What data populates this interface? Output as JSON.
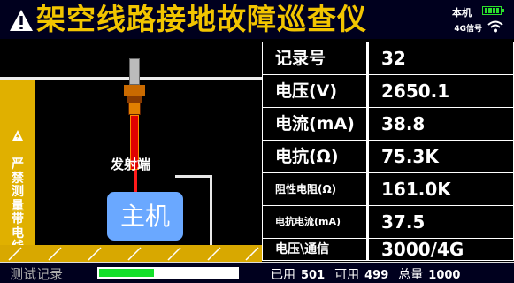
{
  "header": {
    "title": "架空线路接地故障巡查仪",
    "host_label": "本机",
    "signal_label": "4G信号",
    "battery_level": 1.0,
    "title_color": "#f2c500"
  },
  "scene": {
    "warning_text": "严禁测量带电线路",
    "emitter_label": "发射端",
    "host_box_label": "主机"
  },
  "table": {
    "rows": [
      {
        "label": "记录号",
        "value": "32"
      },
      {
        "label": "电压(V)",
        "value": "2650.1"
      },
      {
        "label": "电流(mA)",
        "value": "38.8"
      },
      {
        "label": "电抗(Ω)",
        "value": "75.3K"
      },
      {
        "label": "阻性电阻(Ω)",
        "value": "161.0K"
      },
      {
        "label": "电抗电流(mA)",
        "value": "37.5"
      },
      {
        "label": "电压\\通信",
        "value": "3000/4G"
      }
    ]
  },
  "footer": {
    "record_label": "测试记录",
    "record_progress": 0.4,
    "used_label": "已用",
    "used_value": "501",
    "available_label": "可用",
    "available_value": "499",
    "total_label": "总量",
    "total_value": "1000"
  }
}
